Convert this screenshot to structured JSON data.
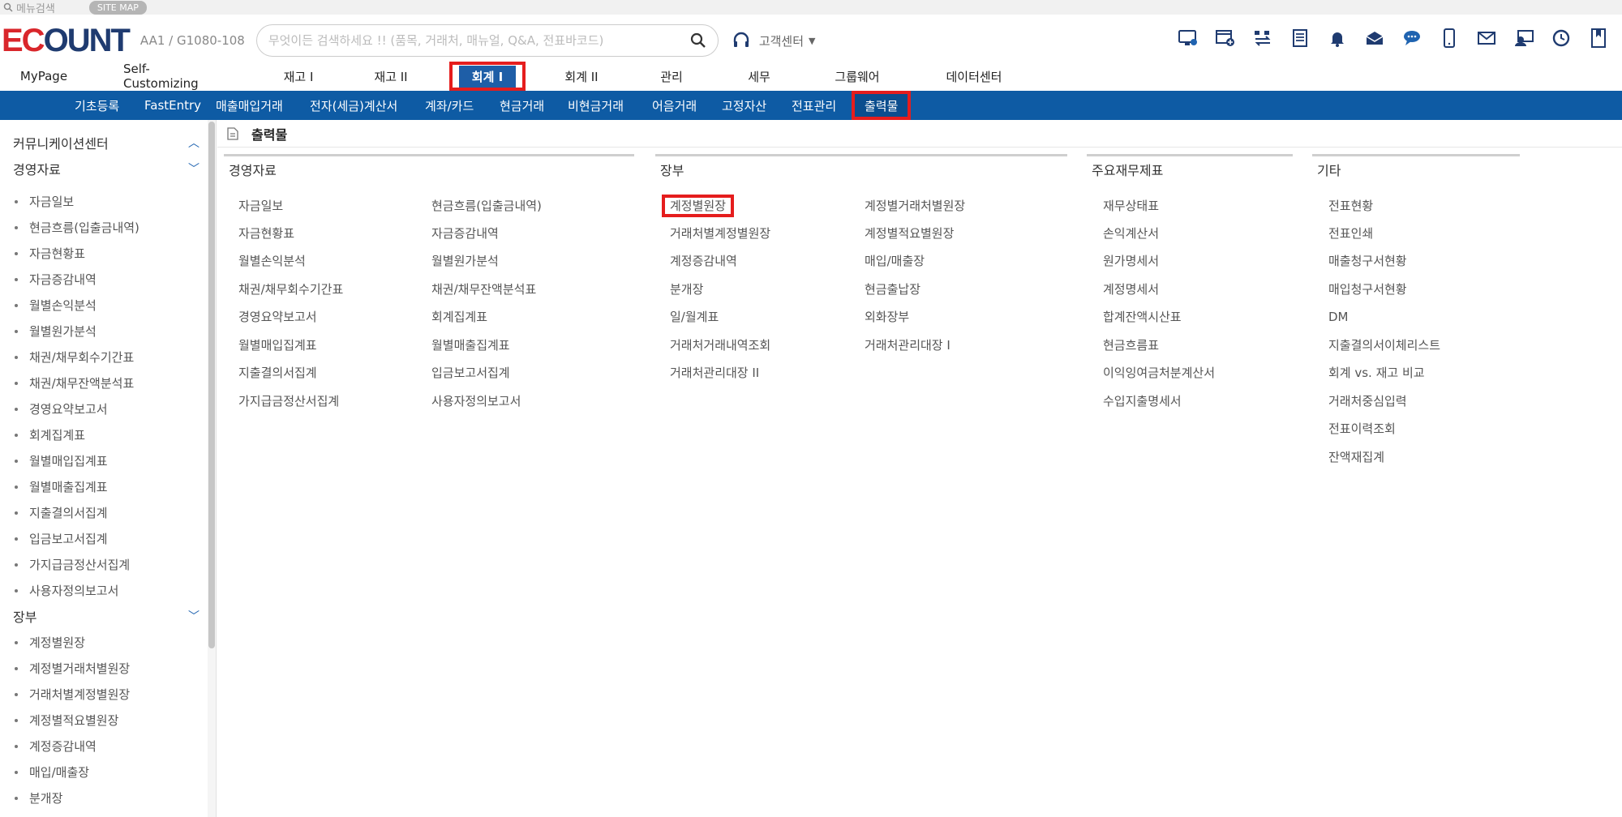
{
  "topbar": {
    "menu_search": "메뉴검색",
    "site_map": "SITE MAP"
  },
  "header": {
    "logo_left": "EC",
    "logo_right": "OUNT",
    "company_code": "AA1 / G1080-108",
    "search_placeholder": "무엇이든 검색하세요 !! (품목, 거래처, 매뉴얼, Q&A, 전표바코드)",
    "customer_center": "고객센터"
  },
  "main_tabs": [
    "MyPage",
    "Self-Customizing",
    "재고 I",
    "재고 II",
    "회계 I",
    "회계 II",
    "관리",
    "세무",
    "그룹웨어",
    "데이터센터"
  ],
  "sub_nav": [
    "기초등록",
    "FastEntry",
    "매출매입거래",
    "전자(세금)계산서",
    "계좌/카드",
    "현금거래",
    "비현금거래",
    "어음거래",
    "고정자산",
    "전표관리",
    "출력물"
  ],
  "sidebar": {
    "group_comm": "커뮤니케이션센터",
    "group_mgmt": "경영자료",
    "mgmt_items": [
      "자금일보",
      "현금흐름(입출금내역)",
      "자금현황표",
      "자금증감내역",
      "월별손익분석",
      "월별원가분석",
      "채권/채무회수기간표",
      "채권/채무잔액분석표",
      "경영요약보고서",
      "회계집계표",
      "월별매입집계표",
      "월별매출집계표",
      "지출결의서집계",
      "입금보고서집계",
      "가지급금정산서집계",
      "사용자정의보고서"
    ],
    "group_ledger": "장부",
    "ledger_items": [
      "계정별원장",
      "계정별거래처별원장",
      "거래처별계정별원장",
      "계정별적요별원장",
      "계정증감내역",
      "매입/매출장",
      "분개장"
    ]
  },
  "content": {
    "title": "출력물",
    "sections": [
      {
        "head": "경영자료",
        "col1": [
          "자금일보",
          "자금현황표",
          "월별손익분석",
          "채권/채무회수기간표",
          "경영요약보고서",
          "월별매입집계표",
          "지출결의서집계",
          "가지급금정산서집계"
        ],
        "col2": [
          "현금흐름(입출금내역)",
          "자금증감내역",
          "월별원가분석",
          "채권/채무잔액분석표",
          "회계집계표",
          "월별매출집계표",
          "입금보고서집계",
          "사용자정의보고서"
        ]
      },
      {
        "head": "장부",
        "col1": [
          "계정별원장",
          "거래처별계정별원장",
          "계정증감내역",
          "분개장",
          "일/월계표",
          "거래처거래내역조회",
          "거래처관리대장 II"
        ],
        "col2": [
          "계정별거래처별원장",
          "계정별적요별원장",
          "매입/매출장",
          "현금출납장",
          "외화장부",
          "거래처관리대장 I"
        ]
      },
      {
        "head": "주요재무제표",
        "col1": [
          "재무상태표",
          "손익계산서",
          "원가명세서",
          "계정명세서",
          "합계잔액시산표",
          "현금흐름표",
          "이익잉여금처분계산서",
          "수입지출명세서"
        ]
      },
      {
        "head": "기타",
        "col1": [
          "전표현황",
          "전표인쇄",
          "매출청구서현황",
          "매입청구서현황",
          "DM",
          "지출결의서이체리스트",
          "회계 vs. 재고 비교",
          "거래처중심입력",
          "전표이력조회",
          "잔액재집계"
        ]
      }
    ]
  },
  "colors": {
    "nav_blue": "#0e5ba4",
    "highlight_red": "#e51d1d",
    "logo_red": "#d9262b",
    "logo_navy": "#1f3b70"
  },
  "icons": [
    "desktop-icon",
    "add-window-icon",
    "transfer-icon",
    "list-icon",
    "bell-icon",
    "mail-open-icon",
    "chat-icon",
    "mobile-icon",
    "mail-icon",
    "user-card-icon",
    "clock-icon",
    "bookmark-icon"
  ]
}
